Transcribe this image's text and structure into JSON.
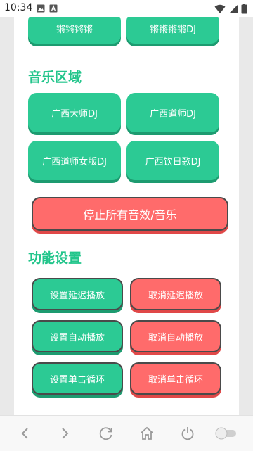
{
  "status_bar": {
    "time": "10:34",
    "left_icons": [
      "image-icon",
      "a-badge-icon"
    ],
    "right_icons": [
      "wifi-icon",
      "signal-icon",
      "battery-icon"
    ]
  },
  "top_buttons": [
    "锵锵锵锵",
    "锵锵锵锵DJ"
  ],
  "music_section": {
    "title": "音乐区域",
    "buttons": [
      "广西大师DJ",
      "广西道师DJ",
      "广西道师女版DJ",
      "广西饮日歌DJ"
    ]
  },
  "stop_button": "停止所有音效/音乐",
  "function_section": {
    "title": "功能设置",
    "buttons": [
      {
        "set": "设置延迟播放",
        "cancel": "取消延迟播放"
      },
      {
        "set": "设置自动播放",
        "cancel": "取消自动播放"
      },
      {
        "set": "设置单击循环",
        "cancel": "取消单击循环"
      }
    ]
  },
  "bottom_nav": [
    "back-icon",
    "forward-icon",
    "refresh-icon",
    "home-icon",
    "power-icon",
    "toggle-icon"
  ],
  "colors": {
    "green": "#2cca94",
    "green_shadow": "#1d9b70",
    "red": "#ff6b6b",
    "red_shadow": "#e04848",
    "title_green": "#22c58b"
  }
}
